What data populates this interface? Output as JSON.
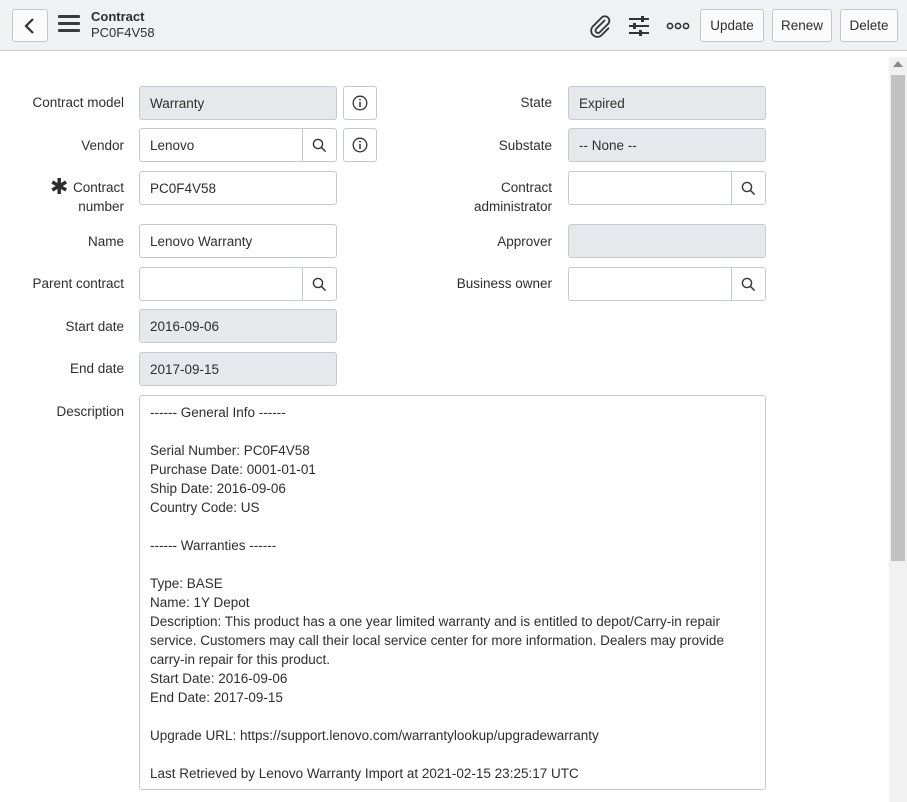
{
  "header": {
    "title": "Contract",
    "subtitle": "PC0F4V58",
    "update_label": "Update",
    "renew_label": "Renew",
    "delete_label": "Delete"
  },
  "form": {
    "contract_model": {
      "label": "Contract model",
      "value": "Warranty"
    },
    "vendor": {
      "label": "Vendor",
      "value": "Lenovo"
    },
    "contract_number": {
      "label_line1": "Contract",
      "label_line2": "number",
      "value": "PC0F4V58"
    },
    "name": {
      "label": "Name",
      "value": "Lenovo Warranty"
    },
    "parent_contract": {
      "label": "Parent contract",
      "value": ""
    },
    "start_date": {
      "label": "Start date",
      "value": "2016-09-06"
    },
    "end_date": {
      "label": "End date",
      "value": "2017-09-15"
    },
    "state": {
      "label": "State",
      "value": "Expired"
    },
    "substate": {
      "label": "Substate",
      "value": "-- None --"
    },
    "contract_administrator": {
      "label_line1": "Contract",
      "label_line2": "administrator",
      "value": ""
    },
    "approver": {
      "label": "Approver",
      "value": ""
    },
    "business_owner": {
      "label": "Business owner",
      "value": ""
    },
    "description": {
      "label": "Description",
      "value": "------ General Info ------\n\nSerial Number: PC0F4V58\nPurchase Date: 0001-01-01\nShip Date: 2016-09-06\nCountry Code: US\n\n------ Warranties ------\n\nType: BASE\nName: 1Y Depot\nDescription: This product has a one year limited warranty and is entitled to depot/Carry-in repair service. Customers may call their local service center for more information. Dealers may provide carry-in repair for this product.\nStart Date: 2016-09-06\nEnd Date: 2017-09-15\n\nUpgrade URL: https://support.lenovo.com/warrantylookup/upgradewarranty\n\nLast Retrieved by Lenovo Warranty Import at 2021-02-15 23:25:17 UTC"
    }
  },
  "icons": {
    "back": "chevron-left-icon",
    "menu": "hamburger-menu-icon",
    "attach": "paperclip-icon",
    "personalize": "sliders-icon",
    "more": "more-options-icon",
    "lookup": "search-icon",
    "info": "info-icon"
  }
}
